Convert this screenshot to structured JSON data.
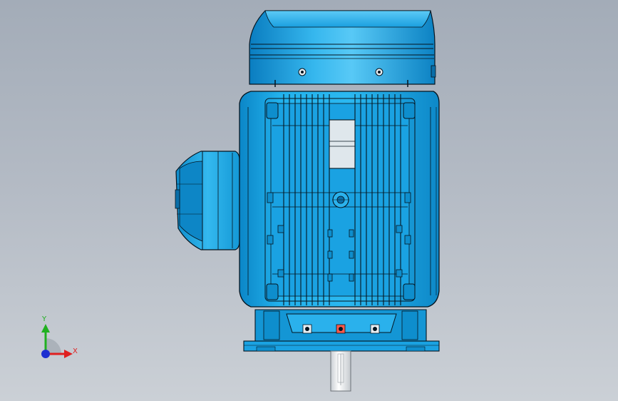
{
  "viewport": {
    "background_top": "#a3acb8",
    "background_bottom": "#cbd0d6"
  },
  "model": {
    "body_color": "#1ea7e6",
    "body_light": "#4fc6f4",
    "body_dark": "#0a7fc0",
    "outline_color": "#05141f",
    "shaft_color": "#f2f4f6"
  },
  "triad": {
    "x_label": "X",
    "y_label": "Y",
    "x_color": "#e02020",
    "y_color": "#20b020",
    "z_color": "#1c2fd0"
  }
}
